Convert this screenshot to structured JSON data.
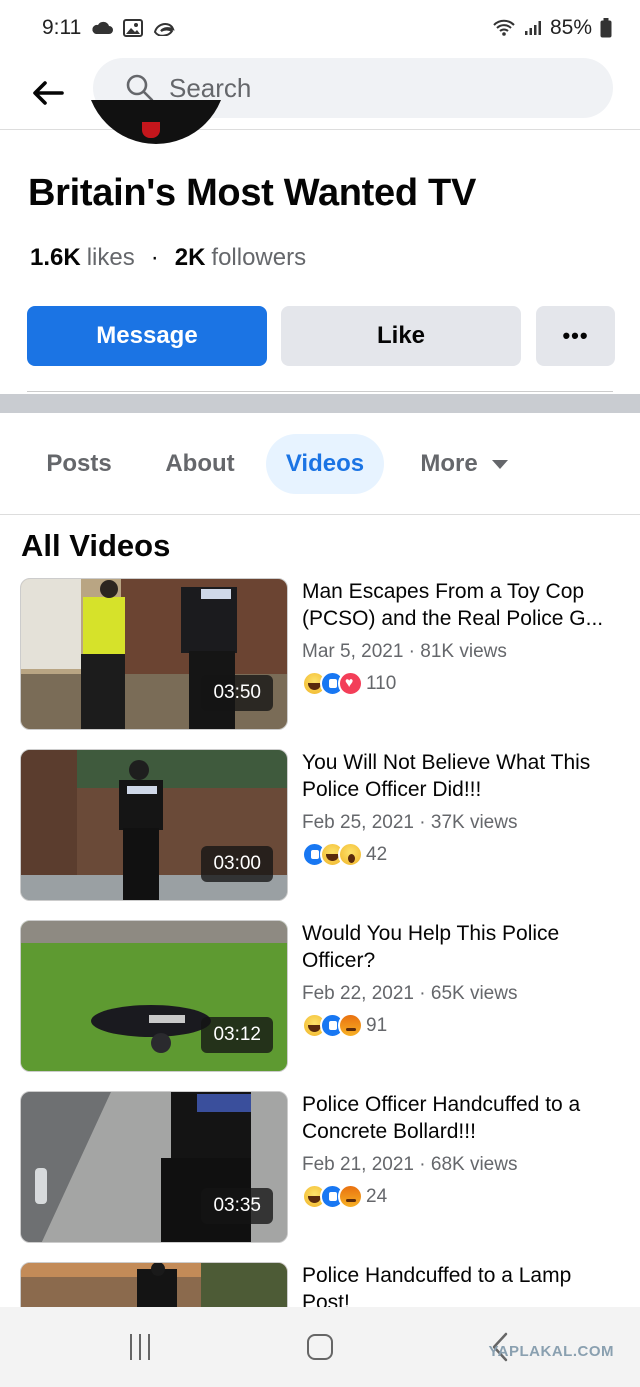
{
  "status_bar": {
    "time": "9:11",
    "battery": "85%"
  },
  "header": {
    "search_placeholder": "Search"
  },
  "page": {
    "name": "Britain's Most Wanted TV",
    "likes_count": "1.6K",
    "likes_label": "likes",
    "followers_count": "2K",
    "followers_label": "followers"
  },
  "actions": {
    "message": "Message",
    "like": "Like",
    "more": "•••"
  },
  "tabs": [
    {
      "label": "Posts",
      "active": false
    },
    {
      "label": "About",
      "active": false
    },
    {
      "label": "Videos",
      "active": true
    },
    {
      "label": "More",
      "active": false
    }
  ],
  "section_title": "All Videos",
  "videos": [
    {
      "title": "Man Escapes From a Toy Cop (PCSO) and the Real Police G...",
      "date": "Mar 5, 2021",
      "views": "81K views",
      "reactions": [
        "haha",
        "like",
        "love"
      ],
      "reaction_count": "110",
      "duration": "03:50"
    },
    {
      "title": "You Will Not Believe What This Police Officer Did!!!",
      "date": "Feb 25, 2021",
      "views": "37K views",
      "reactions": [
        "like",
        "haha",
        "wow"
      ],
      "reaction_count": "42",
      "duration": "03:00"
    },
    {
      "title": "Would You Help This Police Officer?",
      "date": "Feb 22, 2021",
      "views": "65K views",
      "reactions": [
        "haha",
        "like",
        "angry"
      ],
      "reaction_count": "91",
      "duration": "03:12"
    },
    {
      "title": "Police Officer Handcuffed to a Concrete Bollard!!!",
      "date": "Feb 21, 2021",
      "views": "68K views",
      "reactions": [
        "haha",
        "like",
        "angry"
      ],
      "reaction_count": "24",
      "duration": "03:35"
    },
    {
      "title": "Police Handcuffed to a Lamp Post!",
      "date": "",
      "views": "",
      "reactions": [],
      "reaction_count": "",
      "duration": ""
    }
  ],
  "watermark": "YAPLAKAL.COM",
  "colors": {
    "accent": "#1b74e4",
    "active_tab_bg": "#e7f3ff",
    "secondary_button": "#e4e6eb"
  }
}
